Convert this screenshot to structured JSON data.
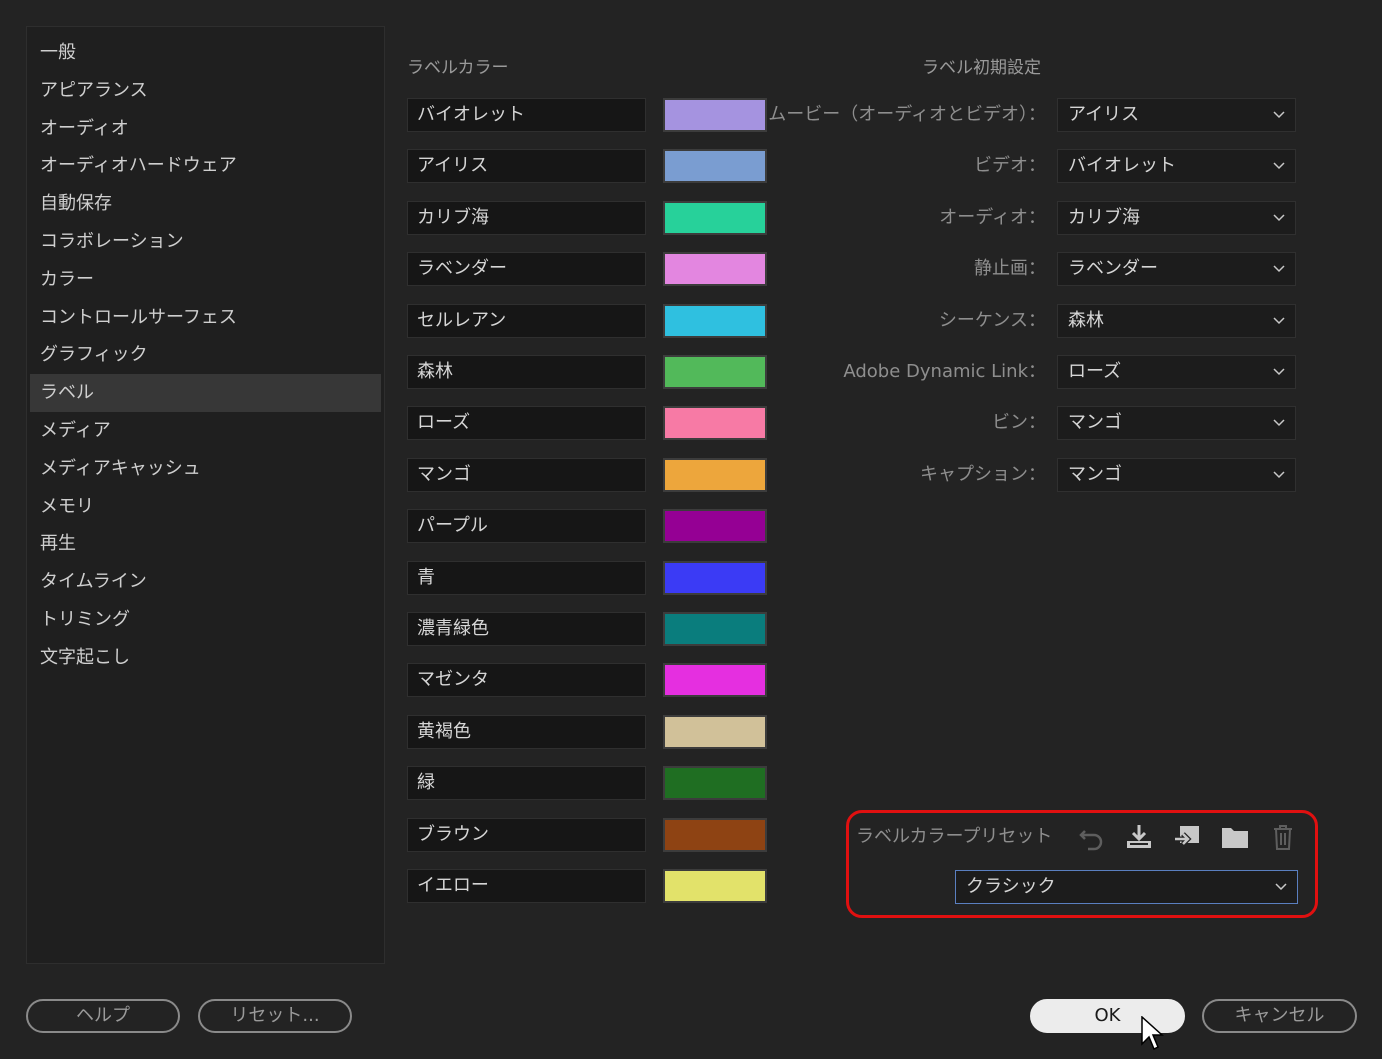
{
  "sidebar": {
    "items": [
      "一般",
      "アピアランス",
      "オーディオ",
      "オーディオハードウェア",
      "自動保存",
      "コラボレーション",
      "カラー",
      "コントロールサーフェス",
      "グラフィック",
      "ラベル",
      "メディア",
      "メディアキャッシュ",
      "メモリ",
      "再生",
      "タイムライン",
      "トリミング",
      "文字起こし"
    ],
    "selected": "ラベル"
  },
  "label_colors": {
    "heading": "ラベルカラー",
    "items": [
      {
        "name": "バイオレット",
        "color": "#a593e0"
      },
      {
        "name": "アイリス",
        "color": "#7a9dd1"
      },
      {
        "name": "カリブ海",
        "color": "#27d19a"
      },
      {
        "name": "ラベンダー",
        "color": "#e386e0"
      },
      {
        "name": "セルレアン",
        "color": "#2fc0e0"
      },
      {
        "name": "森林",
        "color": "#52b95a"
      },
      {
        "name": "ローズ",
        "color": "#f77aa5"
      },
      {
        "name": "マンゴ",
        "color": "#eda63c"
      },
      {
        "name": "パープル",
        "color": "#950094"
      },
      {
        "name": "青",
        "color": "#3b3bf5"
      },
      {
        "name": "濃青緑色",
        "color": "#0a7d7d"
      },
      {
        "name": "マゼンタ",
        "color": "#e52fe0"
      },
      {
        "name": "黄褐色",
        "color": "#d1c199"
      },
      {
        "name": "緑",
        "color": "#1f6e22"
      },
      {
        "name": "ブラウン",
        "color": "#8e4313"
      },
      {
        "name": "イエロー",
        "color": "#e2e26a"
      }
    ]
  },
  "label_defaults": {
    "heading": "ラベル初期設定",
    "rows": [
      {
        "label": "ムービー（オーディオとビデオ）：",
        "value": "アイリス"
      },
      {
        "label": "ビデオ：",
        "value": "バイオレット"
      },
      {
        "label": "オーディオ：",
        "value": "カリブ海"
      },
      {
        "label": "静止画：",
        "value": "ラベンダー"
      },
      {
        "label": "シーケンス：",
        "value": "森林"
      },
      {
        "label": "Adobe Dynamic Link：",
        "value": "ローズ"
      },
      {
        "label": "ビン：",
        "value": "マンゴ"
      },
      {
        "label": "キャプション：",
        "value": "マンゴ"
      }
    ]
  },
  "preset": {
    "label": "ラベルカラープリセット",
    "value": "クラシック",
    "icons": [
      "undo-icon",
      "download-icon",
      "import-icon",
      "folder-icon",
      "trash-icon"
    ]
  },
  "buttons": {
    "help": "ヘルプ",
    "reset": "リセット...",
    "ok": "OK",
    "cancel": "キャンセル"
  }
}
